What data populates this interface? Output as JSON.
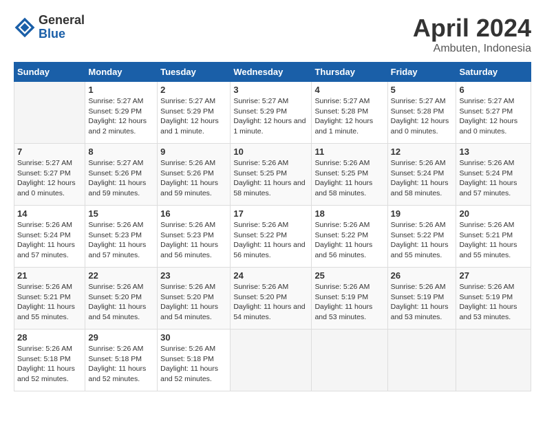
{
  "header": {
    "logo_general": "General",
    "logo_blue": "Blue",
    "month_title": "April 2024",
    "location": "Ambuten, Indonesia"
  },
  "weekdays": [
    "Sunday",
    "Monday",
    "Tuesday",
    "Wednesday",
    "Thursday",
    "Friday",
    "Saturday"
  ],
  "weeks": [
    [
      {
        "day": "",
        "sunrise": "",
        "sunset": "",
        "daylight": ""
      },
      {
        "day": "1",
        "sunrise": "5:27 AM",
        "sunset": "5:29 PM",
        "daylight": "12 hours and 2 minutes."
      },
      {
        "day": "2",
        "sunrise": "5:27 AM",
        "sunset": "5:29 PM",
        "daylight": "12 hours and 1 minute."
      },
      {
        "day": "3",
        "sunrise": "5:27 AM",
        "sunset": "5:29 PM",
        "daylight": "12 hours and 1 minute."
      },
      {
        "day": "4",
        "sunrise": "5:27 AM",
        "sunset": "5:28 PM",
        "daylight": "12 hours and 1 minute."
      },
      {
        "day": "5",
        "sunrise": "5:27 AM",
        "sunset": "5:28 PM",
        "daylight": "12 hours and 0 minutes."
      },
      {
        "day": "6",
        "sunrise": "5:27 AM",
        "sunset": "5:27 PM",
        "daylight": "12 hours and 0 minutes."
      }
    ],
    [
      {
        "day": "7",
        "sunrise": "5:27 AM",
        "sunset": "5:27 PM",
        "daylight": "12 hours and 0 minutes."
      },
      {
        "day": "8",
        "sunrise": "5:27 AM",
        "sunset": "5:26 PM",
        "daylight": "11 hours and 59 minutes."
      },
      {
        "day": "9",
        "sunrise": "5:26 AM",
        "sunset": "5:26 PM",
        "daylight": "11 hours and 59 minutes."
      },
      {
        "day": "10",
        "sunrise": "5:26 AM",
        "sunset": "5:25 PM",
        "daylight": "11 hours and 58 minutes."
      },
      {
        "day": "11",
        "sunrise": "5:26 AM",
        "sunset": "5:25 PM",
        "daylight": "11 hours and 58 minutes."
      },
      {
        "day": "12",
        "sunrise": "5:26 AM",
        "sunset": "5:24 PM",
        "daylight": "11 hours and 58 minutes."
      },
      {
        "day": "13",
        "sunrise": "5:26 AM",
        "sunset": "5:24 PM",
        "daylight": "11 hours and 57 minutes."
      }
    ],
    [
      {
        "day": "14",
        "sunrise": "5:26 AM",
        "sunset": "5:24 PM",
        "daylight": "11 hours and 57 minutes."
      },
      {
        "day": "15",
        "sunrise": "5:26 AM",
        "sunset": "5:23 PM",
        "daylight": "11 hours and 57 minutes."
      },
      {
        "day": "16",
        "sunrise": "5:26 AM",
        "sunset": "5:23 PM",
        "daylight": "11 hours and 56 minutes."
      },
      {
        "day": "17",
        "sunrise": "5:26 AM",
        "sunset": "5:22 PM",
        "daylight": "11 hours and 56 minutes."
      },
      {
        "day": "18",
        "sunrise": "5:26 AM",
        "sunset": "5:22 PM",
        "daylight": "11 hours and 56 minutes."
      },
      {
        "day": "19",
        "sunrise": "5:26 AM",
        "sunset": "5:22 PM",
        "daylight": "11 hours and 55 minutes."
      },
      {
        "day": "20",
        "sunrise": "5:26 AM",
        "sunset": "5:21 PM",
        "daylight": "11 hours and 55 minutes."
      }
    ],
    [
      {
        "day": "21",
        "sunrise": "5:26 AM",
        "sunset": "5:21 PM",
        "daylight": "11 hours and 55 minutes."
      },
      {
        "day": "22",
        "sunrise": "5:26 AM",
        "sunset": "5:20 PM",
        "daylight": "11 hours and 54 minutes."
      },
      {
        "day": "23",
        "sunrise": "5:26 AM",
        "sunset": "5:20 PM",
        "daylight": "11 hours and 54 minutes."
      },
      {
        "day": "24",
        "sunrise": "5:26 AM",
        "sunset": "5:20 PM",
        "daylight": "11 hours and 54 minutes."
      },
      {
        "day": "25",
        "sunrise": "5:26 AM",
        "sunset": "5:19 PM",
        "daylight": "11 hours and 53 minutes."
      },
      {
        "day": "26",
        "sunrise": "5:26 AM",
        "sunset": "5:19 PM",
        "daylight": "11 hours and 53 minutes."
      },
      {
        "day": "27",
        "sunrise": "5:26 AM",
        "sunset": "5:19 PM",
        "daylight": "11 hours and 53 minutes."
      }
    ],
    [
      {
        "day": "28",
        "sunrise": "5:26 AM",
        "sunset": "5:18 PM",
        "daylight": "11 hours and 52 minutes."
      },
      {
        "day": "29",
        "sunrise": "5:26 AM",
        "sunset": "5:18 PM",
        "daylight": "11 hours and 52 minutes."
      },
      {
        "day": "30",
        "sunrise": "5:26 AM",
        "sunset": "5:18 PM",
        "daylight": "11 hours and 52 minutes."
      },
      {
        "day": "",
        "sunrise": "",
        "sunset": "",
        "daylight": ""
      },
      {
        "day": "",
        "sunrise": "",
        "sunset": "",
        "daylight": ""
      },
      {
        "day": "",
        "sunrise": "",
        "sunset": "",
        "daylight": ""
      },
      {
        "day": "",
        "sunrise": "",
        "sunset": "",
        "daylight": ""
      }
    ]
  ],
  "labels": {
    "sunrise_prefix": "Sunrise: ",
    "sunset_prefix": "Sunset: ",
    "daylight_prefix": "Daylight: "
  }
}
